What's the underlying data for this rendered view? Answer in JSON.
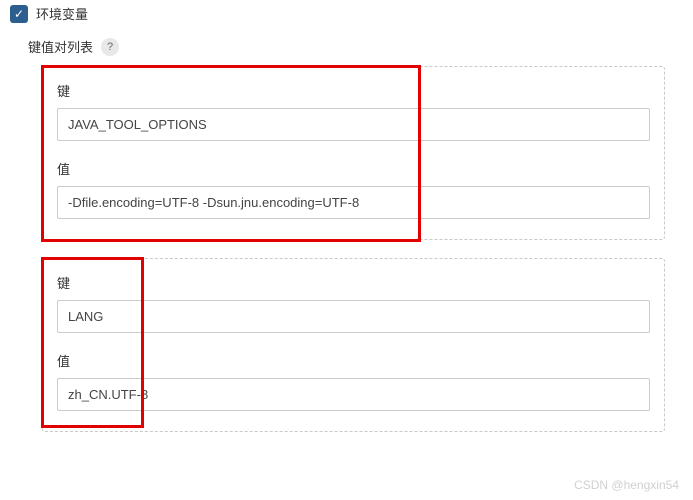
{
  "header": {
    "title": "环境变量"
  },
  "subheader": {
    "label": "键值对列表",
    "help": "?"
  },
  "entries": [
    {
      "key_label": "键",
      "key_value": "JAVA_TOOL_OPTIONS",
      "value_label": "值",
      "value_value": "-Dfile.encoding=UTF-8 -Dsun.jnu.encoding=UTF-8"
    },
    {
      "key_label": "键",
      "key_value": "LANG",
      "value_label": "值",
      "value_value": "zh_CN.UTF-8"
    }
  ],
  "watermark": "CSDN @hengxin54"
}
